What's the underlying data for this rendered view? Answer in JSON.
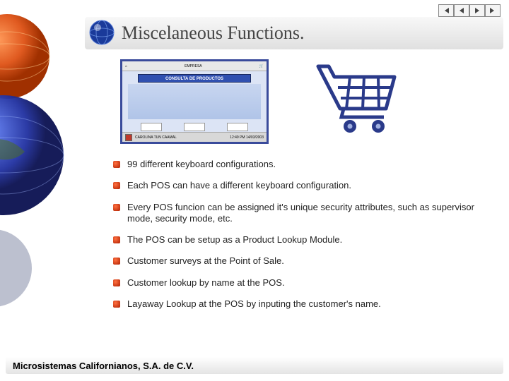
{
  "title": "Miscelaneous Functions.",
  "screenshot": {
    "banner_text": "CONSULTA DE PRODUCTOS",
    "caption": "CAROLINA TUN CAAMAL",
    "time": "12:49 PM  14/03/2003"
  },
  "bullets": [
    "99 different keyboard configurations.",
    "Each POS can have a different keyboard configuration.",
    "Every POS funcion can be assigned it's unique security attributes, such as supervisor mode, security mode, etc.",
    "The POS can be setup as a Product Lookup Module.",
    "Customer surveys at the Point of Sale.",
    "Customer lookup by name at the POS.",
    "Layaway Lookup at the POS by inputing the customer's name."
  ],
  "footer": "Microsistemas Californianos, S.A. de C.V."
}
